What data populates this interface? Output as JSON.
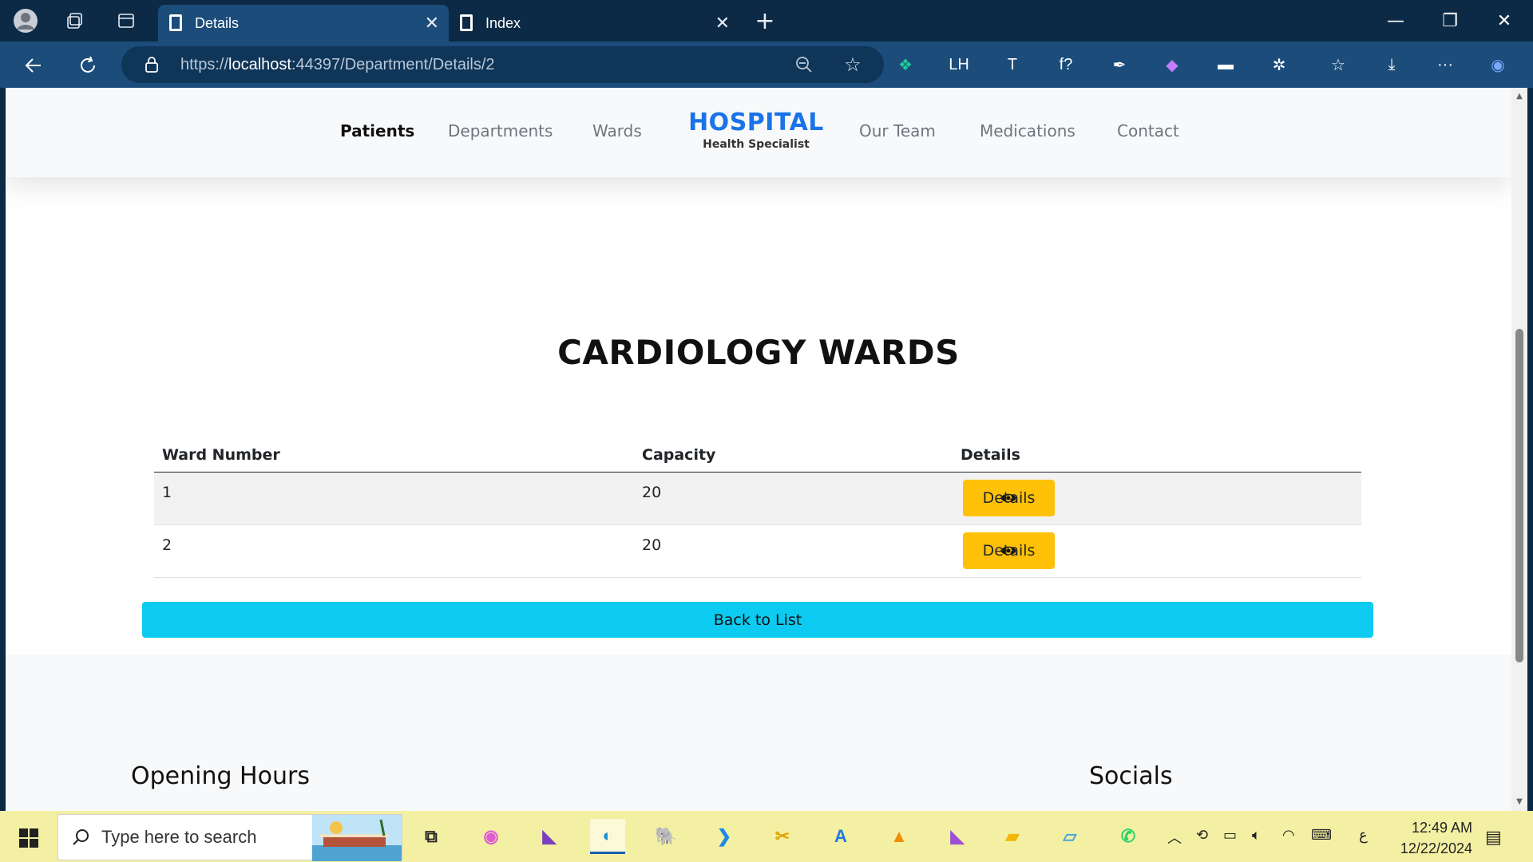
{
  "browser": {
    "tabs": [
      {
        "title": "Details",
        "active": true
      },
      {
        "title": "Index",
        "active": false
      }
    ],
    "new_tab": "+",
    "window_controls": {
      "minimize": "—",
      "restore": "❐",
      "close": "✕"
    },
    "url": {
      "scheme": "https://",
      "host": "localhost",
      "rest": ":44397/Department/Details/2"
    },
    "extensions": [
      {
        "name": "perplexity-icon",
        "glyph": "❖",
        "color": "#20c997"
      },
      {
        "name": "lighthouse-icon",
        "glyph": "LH",
        "color": "#ffffff"
      },
      {
        "name": "text-tool-icon",
        "glyph": "T",
        "color": "#ffffff"
      },
      {
        "name": "font-finder-icon",
        "glyph": "f?",
        "color": "#ffffff"
      },
      {
        "name": "eyedropper-icon",
        "glyph": "✒",
        "color": "#ffffff"
      },
      {
        "name": "gradient-icon",
        "glyph": "◆",
        "color": "#c47cff"
      },
      {
        "name": "cast-icon",
        "glyph": "▬",
        "color": "#ffffff"
      },
      {
        "name": "extensions-icon",
        "glyph": "✲",
        "color": "#ffffff"
      },
      {
        "name": "favorites-icon",
        "glyph": "☆",
        "color": "#ffffff"
      },
      {
        "name": "downloads-icon",
        "glyph": "⤓",
        "color": "#ffffff"
      },
      {
        "name": "more-icon",
        "glyph": "···",
        "color": "#ffffff"
      },
      {
        "name": "copilot-icon",
        "glyph": "◉",
        "color": "#7aa7ff"
      }
    ]
  },
  "navbar": {
    "links": [
      "Patients",
      "Departments",
      "Wards",
      "Our Team",
      "Medications",
      "Contact"
    ],
    "active": "Patients",
    "brand": {
      "name": "HOSPITAL",
      "subtitle": "Health Specialist"
    }
  },
  "page": {
    "title": "CARDIOLOGY WARDS",
    "table": {
      "headers": [
        "Ward Number",
        "Capacity",
        "Details"
      ],
      "rows": [
        {
          "ward_number": "1",
          "capacity": "20",
          "details_label": "Details"
        },
        {
          "ward_number": "2",
          "capacity": "20",
          "details_label": "Details"
        }
      ]
    },
    "back_button": "Back to List"
  },
  "footer": {
    "opening_hours": "Opening Hours",
    "socials": "Socials"
  },
  "taskbar": {
    "search_placeholder": "Type here to search",
    "apps": [
      {
        "name": "task-view-icon",
        "glyph": "⧉",
        "color": "#222"
      },
      {
        "name": "copilot-app-icon",
        "glyph": "◉",
        "color": "#e05bd0"
      },
      {
        "name": "visual-studio-icon",
        "glyph": "◣",
        "color": "#7b3fbf"
      },
      {
        "name": "edge-icon",
        "glyph": "◐",
        "color": "#1c8fd6"
      },
      {
        "name": "postgres-icon",
        "glyph": "🐘",
        "color": "#336791"
      },
      {
        "name": "vscode-icon",
        "glyph": "❯",
        "color": "#1e88e5"
      },
      {
        "name": "snipping-tool-icon",
        "glyph": "✂",
        "color": "#e0a200"
      },
      {
        "name": "azure-data-studio-icon",
        "glyph": "A",
        "color": "#1f7ae0"
      },
      {
        "name": "vlc-icon",
        "glyph": "▲",
        "color": "#f28c00"
      },
      {
        "name": "visual-studio-preview-icon",
        "glyph": "◣",
        "color": "#9d4fd6"
      },
      {
        "name": "file-explorer-icon",
        "glyph": "▰",
        "color": "#f2b705"
      },
      {
        "name": "notepad-icon",
        "glyph": "▱",
        "color": "#4aa3df"
      },
      {
        "name": "whatsapp-icon",
        "glyph": "✆",
        "color": "#25d366"
      }
    ],
    "tray": {
      "language": "ع"
    },
    "time": "12:49 AM",
    "date": "12/22/2024"
  }
}
